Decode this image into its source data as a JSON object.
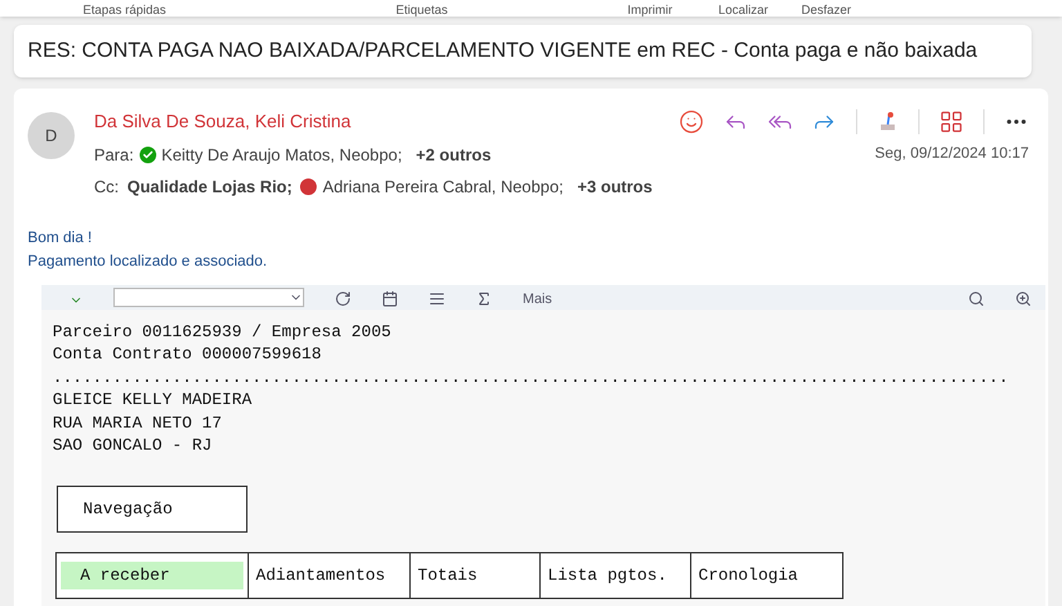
{
  "ribbon": {
    "groups": [
      "Etapas rápidas",
      "Etiquetas",
      "Imprimir",
      "Localizar",
      "Desfazer"
    ]
  },
  "subject": "RES: CONTA PAGA NAO BAIXADA/PARCELAMENTO VIGENTE em REC - Conta paga e não baixada",
  "message": {
    "avatar": "D",
    "sender": "Da Silva De Souza, Keli Cristina",
    "date": "Seg, 09/12/2024 10:17",
    "to_label": "Para:",
    "to": [
      {
        "name": "Keitty De Araujo Matos, Neobpo;",
        "color": "#13a10e",
        "bold": false
      }
    ],
    "to_more": "+2 outros",
    "cc_label": "Cc:",
    "cc": [
      {
        "name": "Qualidade Lojas Rio;",
        "bold": true
      },
      {
        "name": "Adriana Pereira Cabral, Neobpo;",
        "color": "#d13438",
        "bold": false
      }
    ],
    "cc_more": "+3 outros",
    "body": [
      "Bom dia !",
      "Pagamento localizado e associado."
    ]
  },
  "embedded": {
    "toolbar_more": "Mais",
    "lines": [
      "Parceiro 0011625939 / Empresa 2005",
      "Conta Contrato 000007599618",
      "................................................................................................",
      "GLEICE KELLY MADEIRA",
      "RUA MARIA NETO 17",
      "SAO GONCALO - RJ"
    ],
    "nav_button": "Navegação",
    "tabs": [
      {
        "label": "A receber",
        "selected": true
      },
      {
        "label": "Adiantamentos",
        "selected": false
      },
      {
        "label": "Totais",
        "selected": false
      },
      {
        "label": "Lista pgtos.",
        "selected": false
      },
      {
        "label": "Cronologia",
        "selected": false
      }
    ]
  }
}
